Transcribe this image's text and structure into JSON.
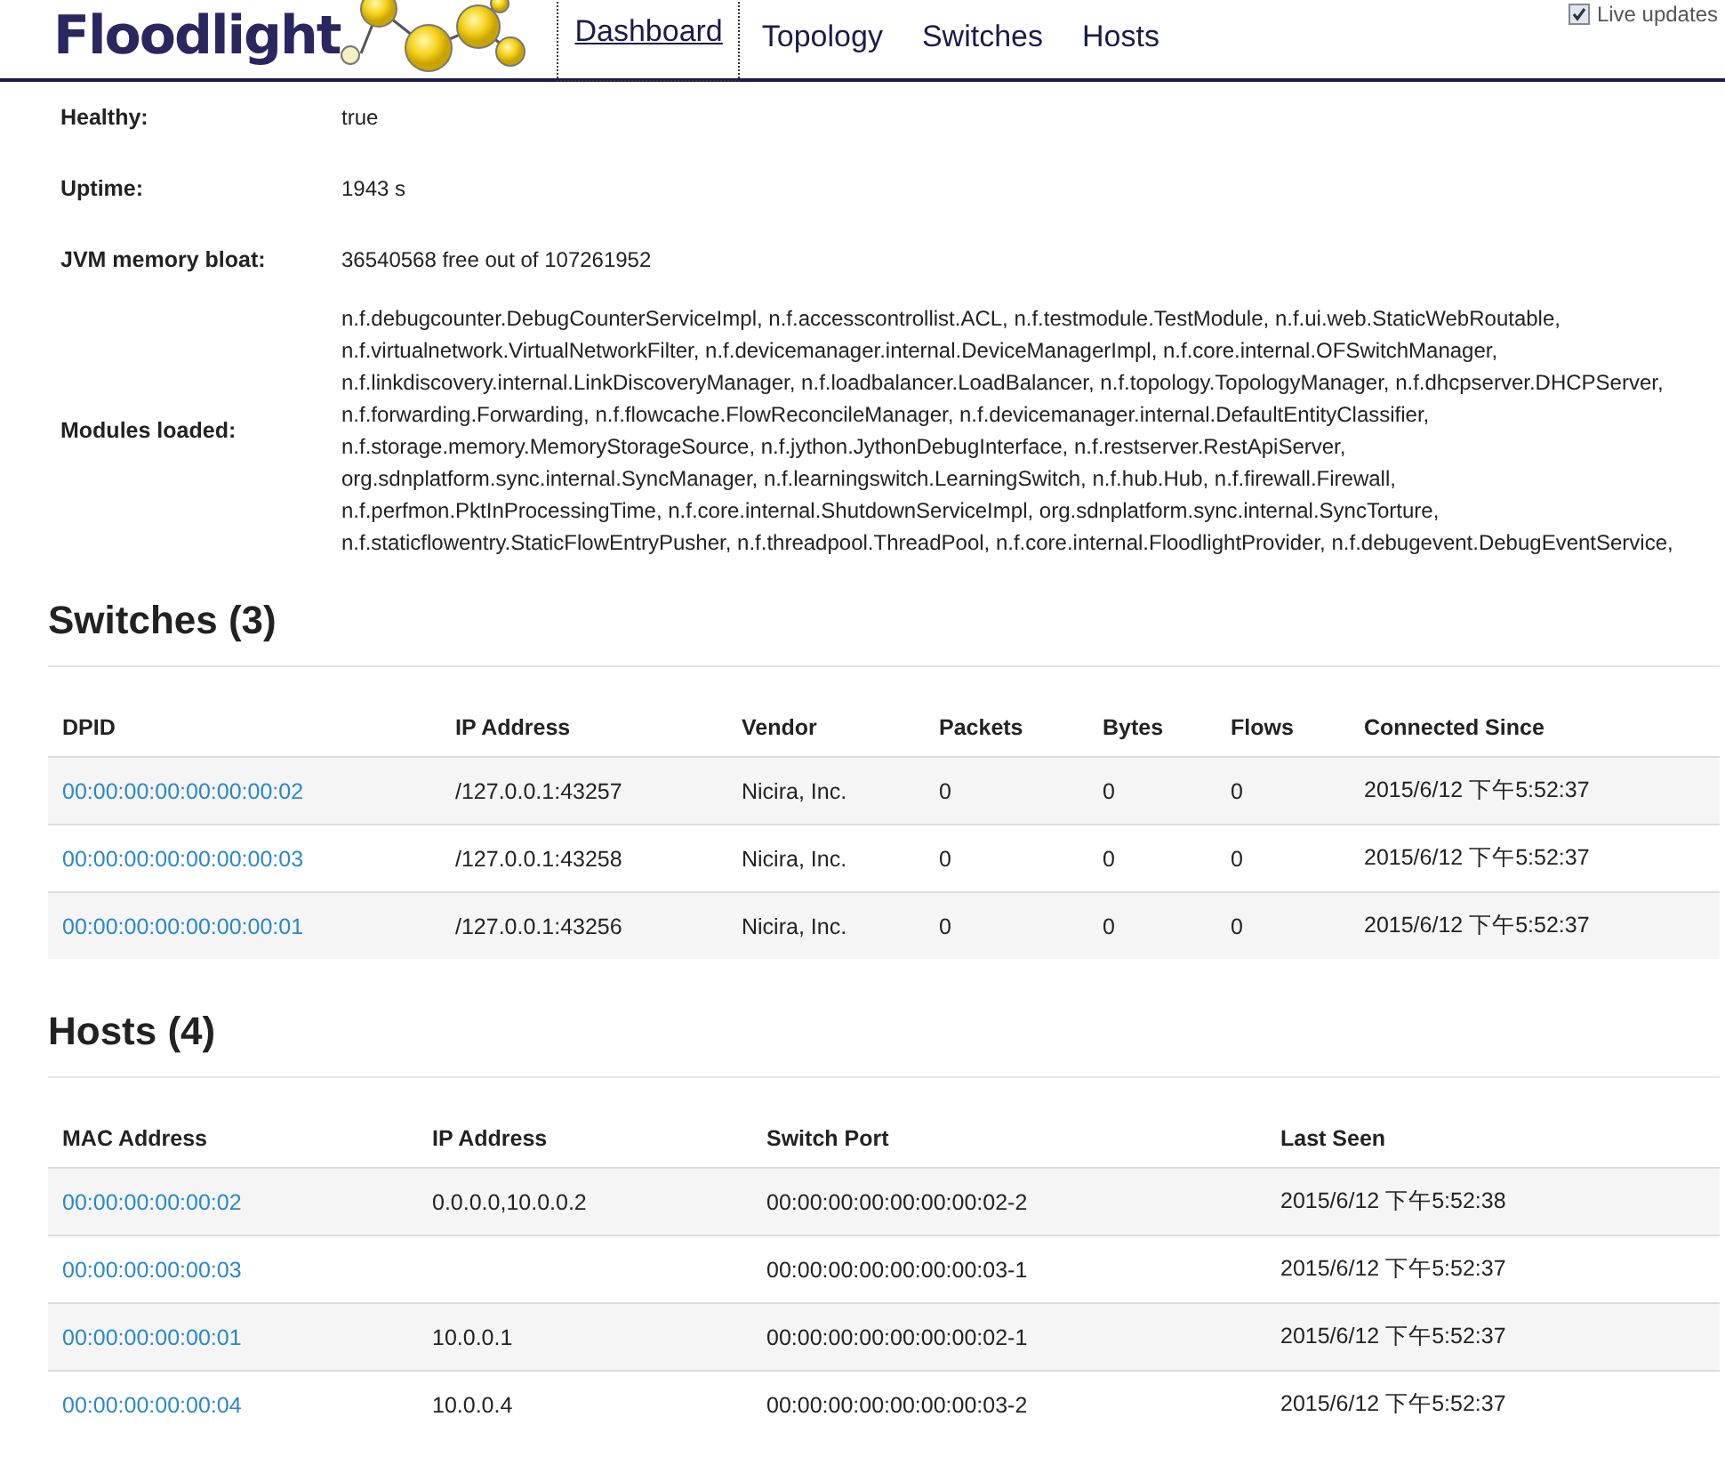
{
  "header": {
    "logo": "Floodlight",
    "tabs": [
      {
        "label": "Dashboard",
        "selected": true
      },
      {
        "label": "Topology",
        "selected": false
      },
      {
        "label": "Switches",
        "selected": false
      },
      {
        "label": "Hosts",
        "selected": false
      }
    ],
    "live_updates": {
      "label": "Live updates",
      "checked": true
    }
  },
  "summary": [
    {
      "label": "Healthy:",
      "value": "true"
    },
    {
      "label": "Uptime:",
      "value": "1943 s"
    },
    {
      "label": "JVM memory bloat:",
      "value": "36540568 free out of 107261952"
    },
    {
      "label": "Modules loaded:",
      "value": "n.f.debugcounter.DebugCounterServiceImpl, n.f.accesscontrollist.ACL, n.f.testmodule.TestModule, n.f.ui.web.StaticWebRoutable, n.f.virtualnetwork.VirtualNetworkFilter, n.f.devicemanager.internal.DeviceManagerImpl, n.f.core.internal.OFSwitchManager, n.f.linkdiscovery.internal.LinkDiscoveryManager, n.f.loadbalancer.LoadBalancer, n.f.topology.TopologyManager, n.f.dhcpserver.DHCPServer, n.f.forwarding.Forwarding, n.f.flowcache.FlowReconcileManager, n.f.devicemanager.internal.DefaultEntityClassifier, n.f.storage.memory.MemoryStorageSource, n.f.jython.JythonDebugInterface, n.f.restserver.RestApiServer, org.sdnplatform.sync.internal.SyncManager, n.f.learningswitch.LearningSwitch, n.f.hub.Hub, n.f.firewall.Firewall, n.f.perfmon.PktInProcessingTime, n.f.core.internal.ShutdownServiceImpl, org.sdnplatform.sync.internal.SyncTorture, n.f.staticflowentry.StaticFlowEntryPusher, n.f.threadpool.ThreadPool, n.f.core.internal.FloodlightProvider, n.f.debugevent.DebugEventService,"
    }
  ],
  "switches": {
    "title": "Switches (3)",
    "columns": [
      "DPID",
      "IP Address",
      "Vendor",
      "Packets",
      "Bytes",
      "Flows",
      "Connected Since"
    ],
    "rows": [
      [
        "00:00:00:00:00:00:00:02",
        "/127.0.0.1:43257",
        "Nicira, Inc.",
        "0",
        "0",
        "0",
        "2015/6/12 下午5:52:37"
      ],
      [
        "00:00:00:00:00:00:00:03",
        "/127.0.0.1:43258",
        "Nicira, Inc.",
        "0",
        "0",
        "0",
        "2015/6/12 下午5:52:37"
      ],
      [
        "00:00:00:00:00:00:00:01",
        "/127.0.0.1:43256",
        "Nicira, Inc.",
        "0",
        "0",
        "0",
        "2015/6/12 下午5:52:37"
      ]
    ]
  },
  "hosts": {
    "title": "Hosts (4)",
    "columns": [
      "MAC Address",
      "IP Address",
      "Switch Port",
      "Last Seen"
    ],
    "rows": [
      [
        "00:00:00:00:00:02",
        "0.0.0.0,10.0.0.2",
        "00:00:00:00:00:00:00:02-2",
        "2015/6/12 下午5:52:38"
      ],
      [
        "00:00:00:00:00:03",
        "",
        "00:00:00:00:00:00:00:03-1",
        "2015/6/12 下午5:52:37"
      ],
      [
        "00:00:00:00:00:01",
        "10.0.0.1",
        "00:00:00:00:00:00:00:02-1",
        "2015/6/12 下午5:52:37"
      ],
      [
        "00:00:00:00:00:04",
        "10.0.0.4",
        "00:00:00:00:00:00:00:03-2",
        "2015/6/12 下午5:52:37"
      ]
    ]
  }
}
